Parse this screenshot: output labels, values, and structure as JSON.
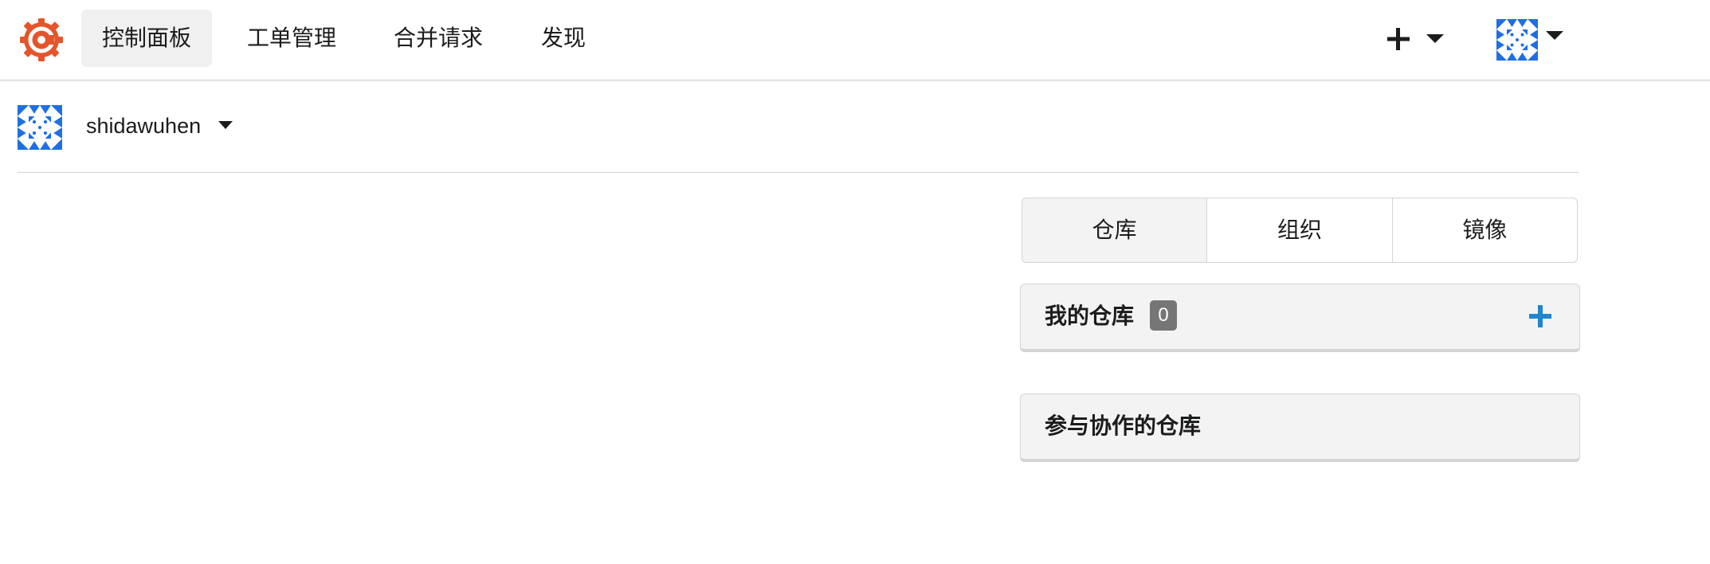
{
  "nav": {
    "items": [
      {
        "label": "控制面板",
        "active": true
      },
      {
        "label": "工单管理",
        "active": false
      },
      {
        "label": "合并请求",
        "active": false
      },
      {
        "label": "发现",
        "active": false
      }
    ],
    "create_icon": "plus-icon",
    "logo_icon": "gitea-logo"
  },
  "context": {
    "username": "shidawuhen"
  },
  "switcher": {
    "items": [
      "仓库",
      "组织",
      "镜像"
    ],
    "active_index": 0
  },
  "panels": {
    "my_repos": {
      "title": "我的仓库",
      "count": "0"
    },
    "collab_repos": {
      "title": "参与协作的仓库"
    }
  },
  "colors": {
    "logo": "#e4552b",
    "avatar": "#1f6fe0",
    "accent_plus": "#2185d0",
    "badge": "#767676"
  }
}
